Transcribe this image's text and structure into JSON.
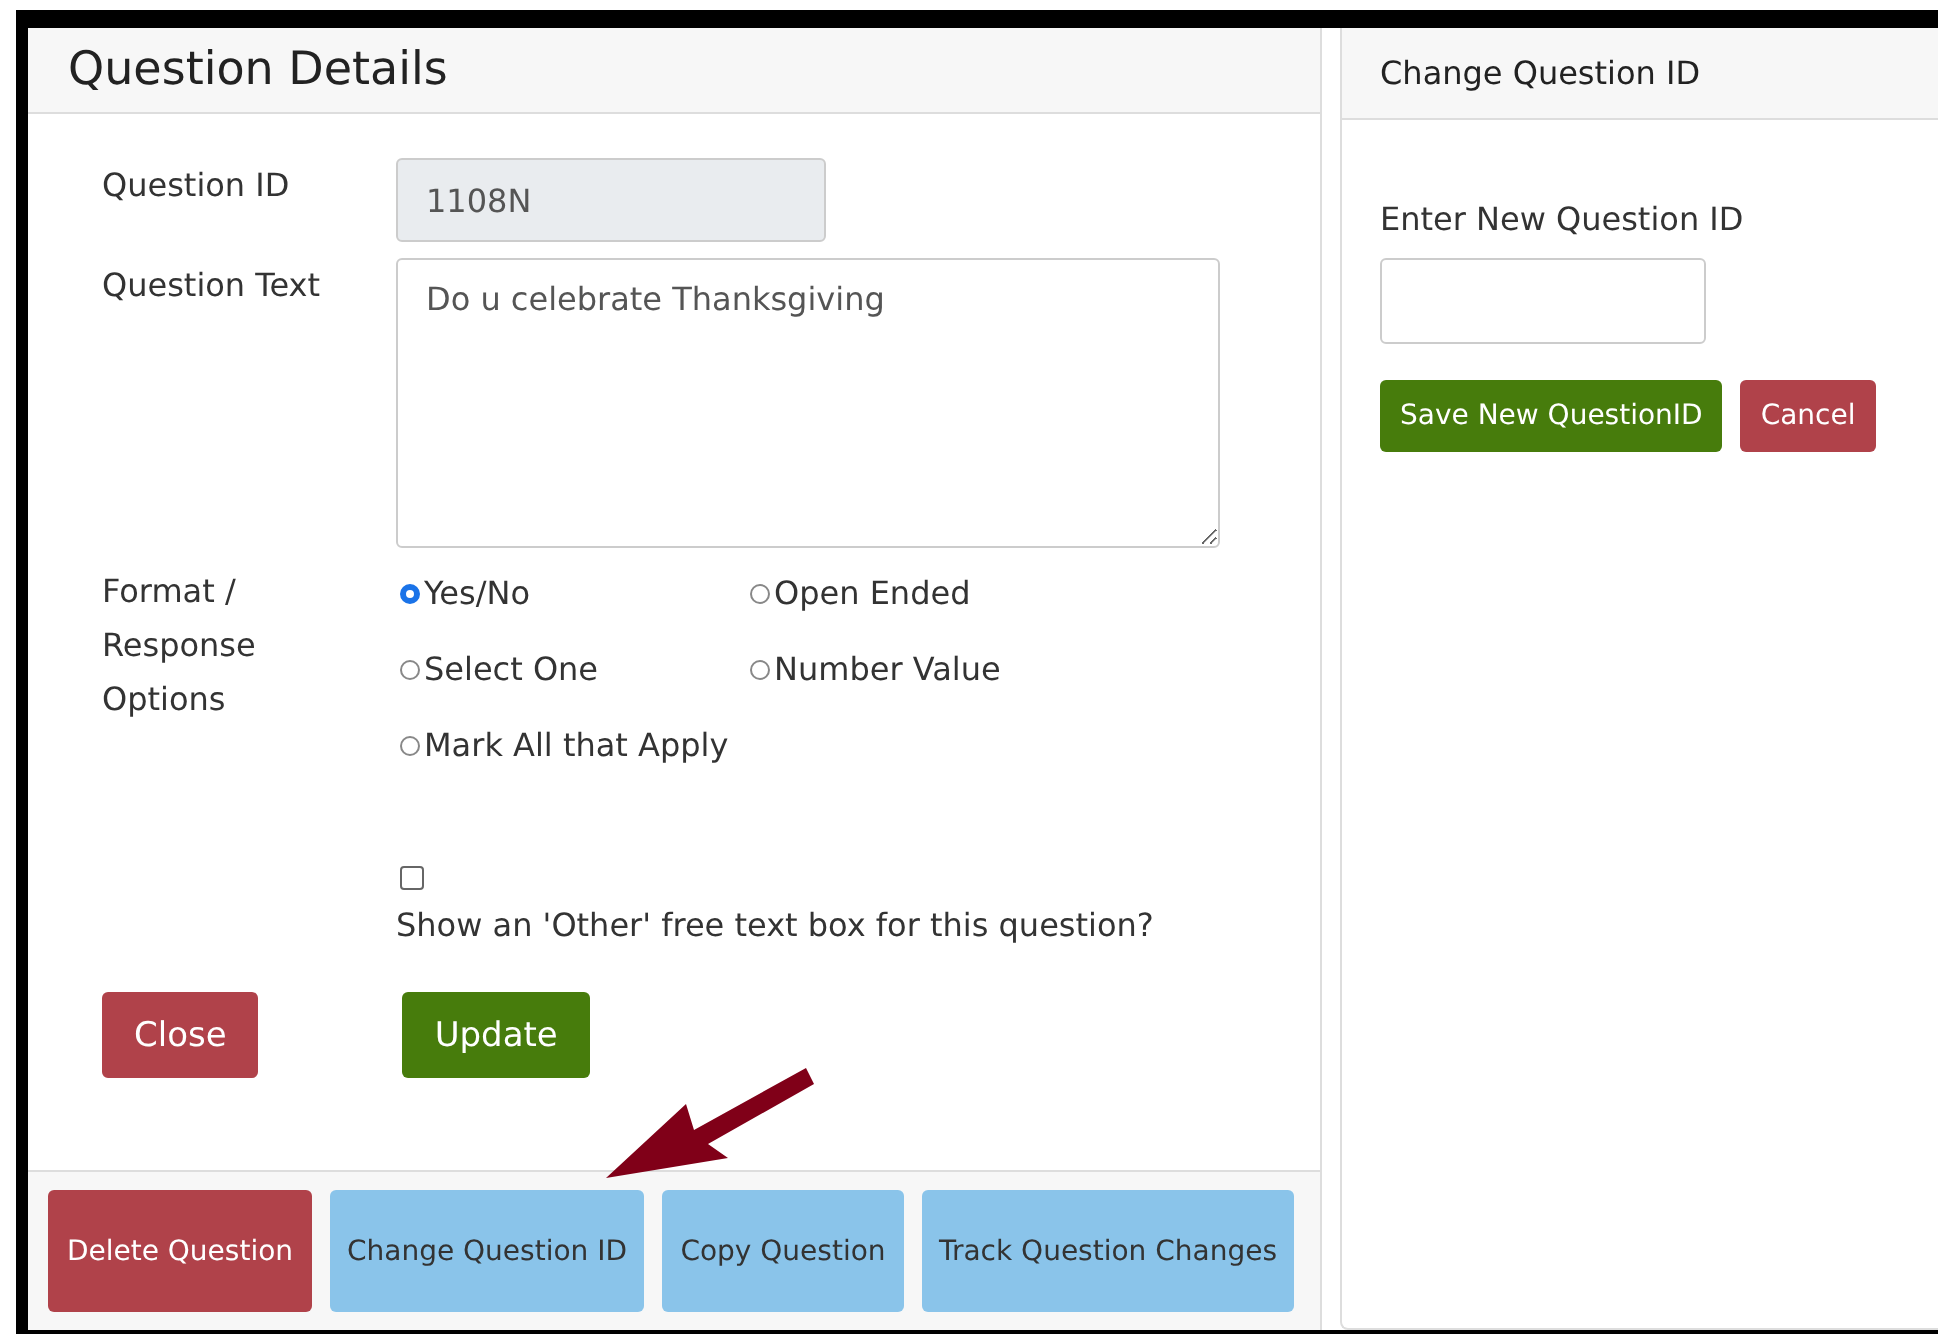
{
  "question_details": {
    "title": "Question Details",
    "fields": [
      {
        "label": "Question ID",
        "kind": "readonly",
        "value": "1108N"
      },
      {
        "label": "Question Text",
        "kind": "textarea",
        "value": "Do u celebrate Thanksgiving"
      }
    ],
    "format": {
      "label": "Format / Response Options",
      "options": [
        {
          "label": "Yes/No",
          "selected": true
        },
        {
          "label": "Open Ended",
          "selected": false
        },
        {
          "label": "Select One",
          "selected": false
        },
        {
          "label": "Number Value",
          "selected": false
        },
        {
          "label": "Mark All that Apply",
          "selected": false
        }
      ]
    },
    "other_box": {
      "checked": false,
      "label": "Show an 'Other' free text box for this question?"
    },
    "actions": [
      {
        "label": "Close",
        "kind": "danger"
      },
      {
        "label": "Update",
        "kind": "success"
      }
    ],
    "footer_buttons": [
      {
        "label": "Delete Question",
        "kind": "danger"
      },
      {
        "label": "Change Question ID",
        "kind": "info"
      },
      {
        "label": "Copy Question",
        "kind": "info"
      },
      {
        "label": "Track Question Changes",
        "kind": "info"
      }
    ]
  },
  "annotation": {
    "kind": "arrow"
  },
  "change_id": {
    "title": "Change Question ID",
    "field_label": "Enter New Question ID",
    "buttons": [
      {
        "label": "Save New QuestionID",
        "kind": "success"
      },
      {
        "label": "Cancel",
        "kind": "danger"
      }
    ]
  }
}
